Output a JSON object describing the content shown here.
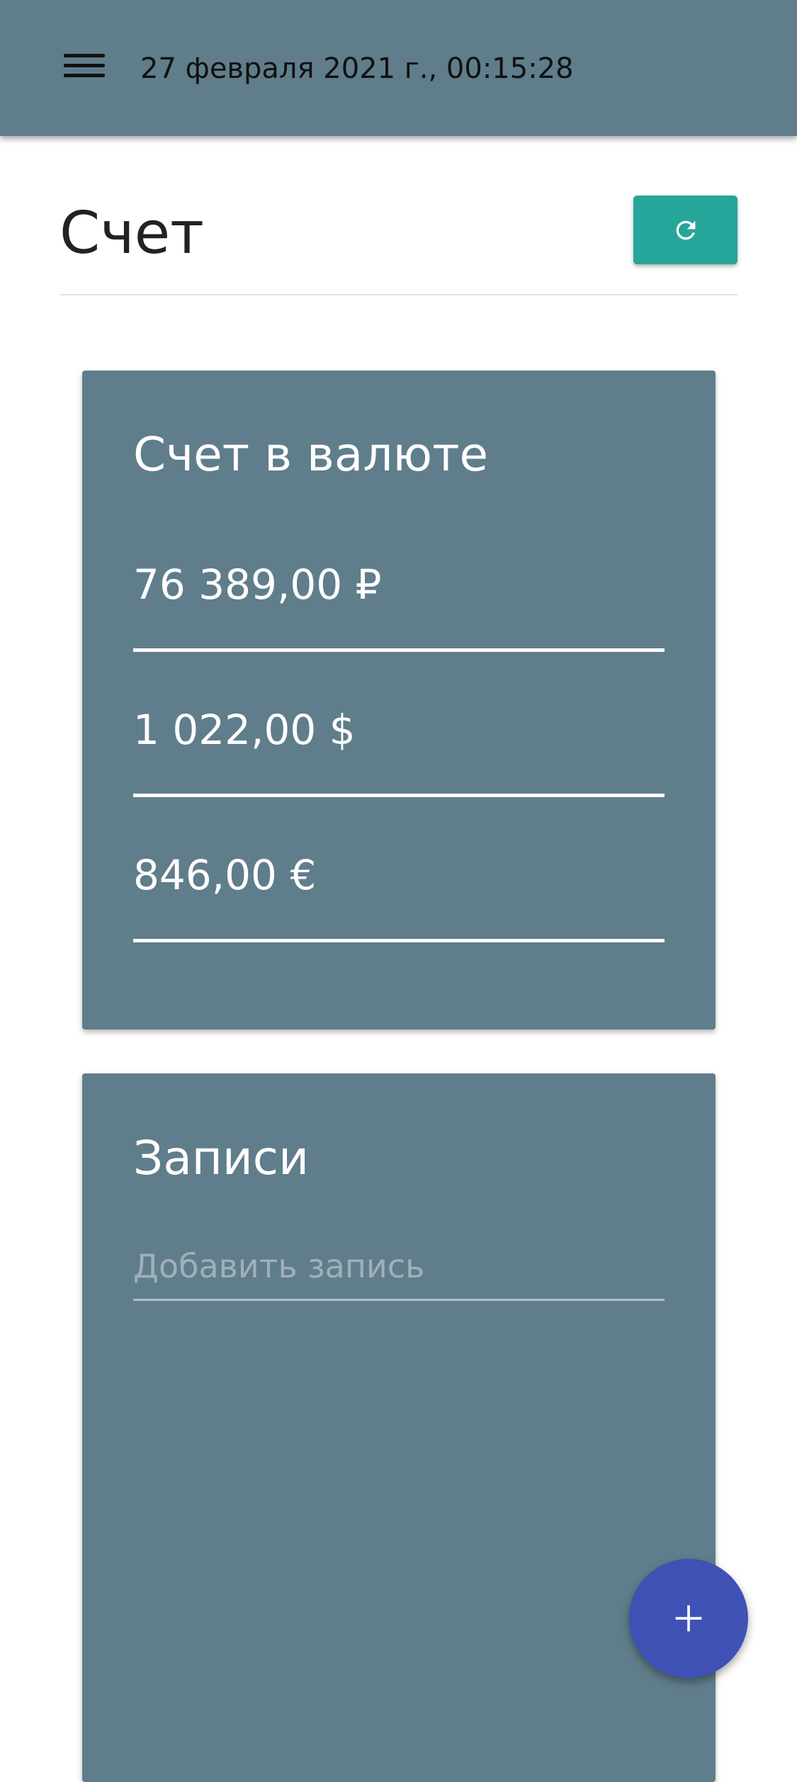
{
  "header": {
    "datetime": "27 февраля 2021 г., 00:15:28",
    "menu_icon": "hamburger-menu-icon"
  },
  "page": {
    "title": "Счет",
    "refresh_icon": "refresh-icon"
  },
  "currency_card": {
    "title": "Счет в валюте",
    "amounts": [
      "76 389,00 ₽",
      "1 022,00 $",
      "846,00 €"
    ]
  },
  "records_card": {
    "title": "Записи",
    "input_placeholder": "Добавить запись",
    "input_value": ""
  },
  "fab": {
    "icon": "plus-icon"
  },
  "colors": {
    "topbar": "#607d8b",
    "card": "#607d8b",
    "refresh_button": "#26a69a",
    "fab": "#3f51b5"
  }
}
